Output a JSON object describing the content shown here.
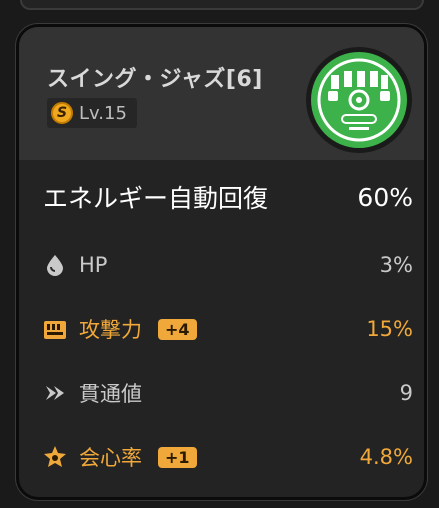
{
  "disc": {
    "name": "スイング・ジャズ[6]",
    "level": "Lv.15",
    "rank_letter": "S",
    "icon_name": "disc-record-icon",
    "icon_color": "#3db14a"
  },
  "main_stat": {
    "label": "エネルギー自動回復",
    "value": "60%"
  },
  "sub_stats": [
    {
      "icon": "hp-drop-icon",
      "label": "HP",
      "bonus": "",
      "value": "3%",
      "highlight": false
    },
    {
      "icon": "attack-fist-icon",
      "label": "攻撃力",
      "bonus": "+4",
      "value": "15%",
      "highlight": true
    },
    {
      "icon": "pen-ratio-icon",
      "label": "貫通値",
      "bonus": "",
      "value": "9",
      "highlight": false
    },
    {
      "icon": "crit-rate-icon",
      "label": "会心率",
      "bonus": "+1",
      "value": "4.8%",
      "highlight": true
    }
  ],
  "colors": {
    "highlight": "#f0a83a",
    "normal_text": "#c9c9c9"
  }
}
